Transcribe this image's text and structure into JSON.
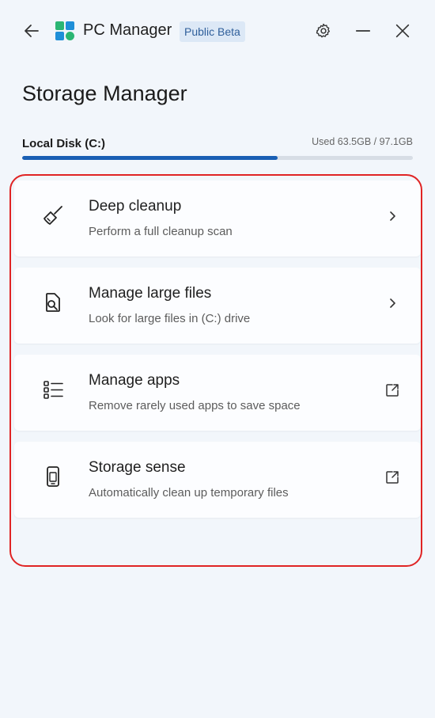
{
  "app": {
    "name": "PC Manager",
    "badge": "Public Beta",
    "icons": {
      "back": "back-arrow-icon",
      "logo": "pc-manager-logo",
      "settings": "gear-icon",
      "minimize": "minimize-icon",
      "close": "close-icon"
    }
  },
  "page": {
    "title": "Storage Manager"
  },
  "disk": {
    "label": "Local Disk (C:)",
    "usage_text": "Used 63.5GB / 97.1GB",
    "used_gb": 63.5,
    "total_gb": 97.1,
    "fill_fraction": 0.654,
    "bar_color": "#1a5fb4"
  },
  "items": [
    {
      "title": "Deep cleanup",
      "description": "Perform a full cleanup scan",
      "icon": "broom-icon",
      "action_icon": "chevron-right-icon"
    },
    {
      "title": "Manage large files",
      "description": "Look for large files in (C:) drive",
      "icon": "file-search-icon",
      "action_icon": "chevron-right-icon"
    },
    {
      "title": "Manage apps",
      "description": "Remove rarely used apps to save space",
      "icon": "app-list-icon",
      "action_icon": "external-link-icon"
    },
    {
      "title": "Storage sense",
      "description": "Automatically clean up temporary files",
      "icon": "phone-storage-icon",
      "action_icon": "external-link-icon"
    }
  ],
  "colors": {
    "background": "#f2f6fb",
    "card": "#fcfdff",
    "highlight": "#e02424",
    "accent": "#1a5fb4",
    "badge_bg": "#dce8f6",
    "badge_text": "#2f5f9b"
  }
}
